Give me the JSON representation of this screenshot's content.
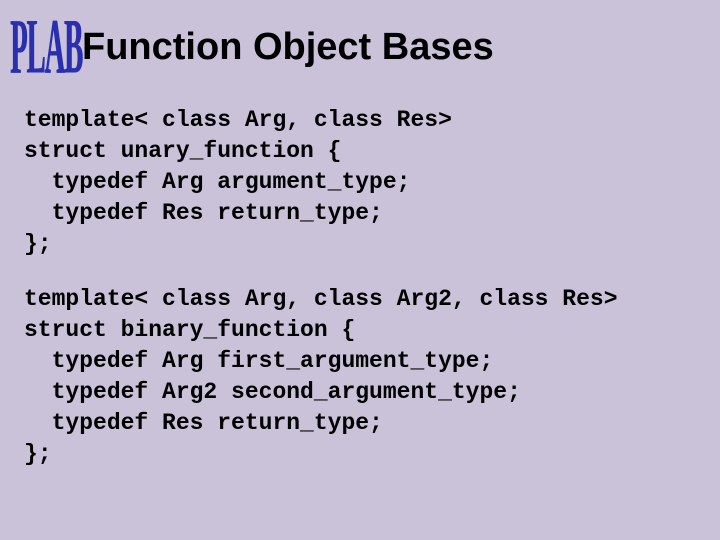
{
  "logo": "PLAB",
  "title": "Function Object Bases",
  "code": {
    "block1": {
      "l1": "template< class Arg, class Res>",
      "l2": "struct unary_function {",
      "l3": "  typedef Arg argument_type;",
      "l4": "  typedef Res return_type;",
      "l5": "};"
    },
    "block2": {
      "l1": "template< class Arg, class Arg2, class Res>",
      "l2": "struct binary_function {",
      "l3": "  typedef Arg first_argument_type;",
      "l4": "  typedef Arg2 second_argument_type;",
      "l5": "  typedef Res return_type;",
      "l6": "};"
    }
  }
}
